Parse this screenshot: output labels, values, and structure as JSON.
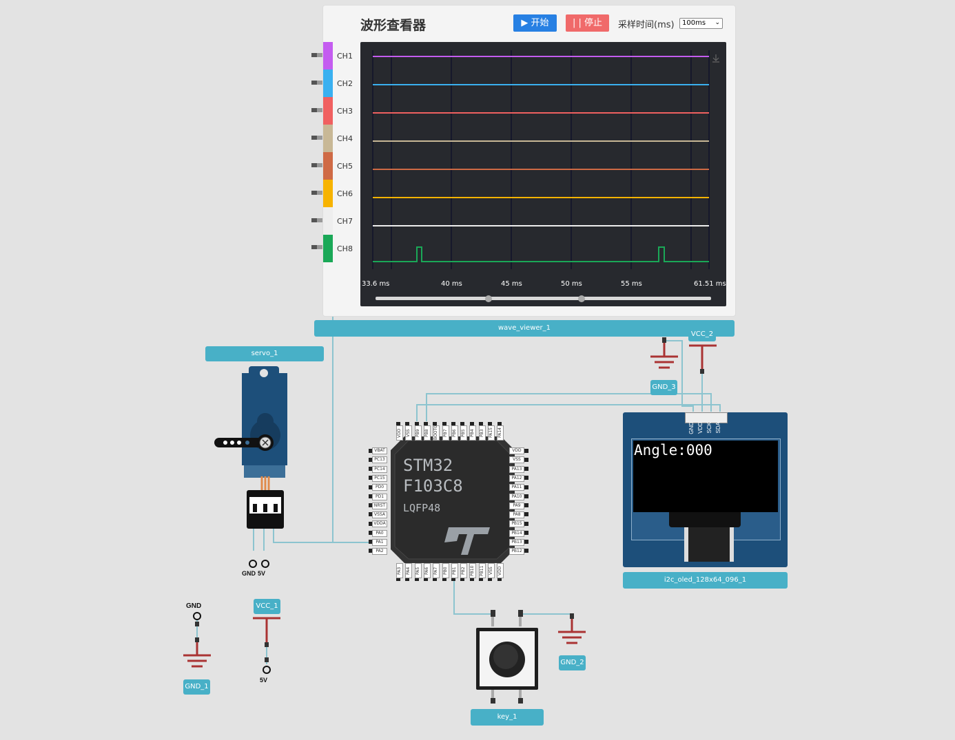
{
  "wave_viewer": {
    "title": "波形查看器",
    "start_label": "▶ 开始",
    "stop_label": "| | 停止",
    "sample_label": "采样时间(ms)",
    "sample_value": "100ms",
    "channels": [
      {
        "label": "CH1",
        "color": "#c45cf0"
      },
      {
        "label": "CH2",
        "color": "#3ab0f0"
      },
      {
        "label": "CH3",
        "color": "#f06060"
      },
      {
        "label": "CH4",
        "color": "#c8b896"
      },
      {
        "label": "CH5",
        "color": "#cf6a45"
      },
      {
        "label": "CH6",
        "color": "#f7b300"
      },
      {
        "label": "CH7",
        "color": "#eeeeee"
      },
      {
        "label": "CH8",
        "color": "#1aa857"
      }
    ],
    "x_ticks": [
      "33.6 ms",
      "40 ms",
      "45 ms",
      "50 ms",
      "55 ms",
      "61.51 ms"
    ],
    "name": "wave_viewer_1"
  },
  "components": {
    "servo": {
      "name": "servo_1",
      "pins": [
        "GND",
        "5V"
      ]
    },
    "mcu": {
      "line1": "STM32",
      "line2": "F103C8",
      "line3": "LQFP48",
      "logo": "ST",
      "top_pins": [
        "VDD",
        "VSS",
        "PB9",
        "PB8",
        "BOOT0",
        "PB7",
        "PB6",
        "PB5",
        "PB4",
        "PB3",
        "PA15",
        "PA14"
      ],
      "left_pins": [
        "VBAT",
        "PC13",
        "PC14",
        "PC15",
        "PD0",
        "PD1",
        "NRST",
        "VSSA",
        "VDDA",
        "PA0",
        "PA1",
        "PA2"
      ],
      "right_pins": [
        "VDD",
        "VSS",
        "PA13",
        "PA12",
        "PA11",
        "PA10",
        "PA9",
        "PA8",
        "PB15",
        "PB14",
        "PB13",
        "PB12"
      ],
      "bottom_pins": [
        "PA3",
        "PA4",
        "PA5",
        "PA6",
        "PA7",
        "PB0",
        "PB1",
        "PB2",
        "PB10",
        "PB11",
        "VSS",
        "VDD"
      ]
    },
    "oled": {
      "name": "i2c_oled_128x64_096_1",
      "pins": [
        "GND",
        "VDD",
        "SCK",
        "SDA"
      ],
      "display_text": "Angle:000"
    },
    "key": {
      "name": "key_1"
    },
    "gnd1": {
      "label": "GND",
      "name": "GND_1"
    },
    "gnd2": {
      "name": "GND_2"
    },
    "gnd3": {
      "name": "GND_3"
    },
    "vcc1": {
      "name": "VCC_1",
      "label": "5V"
    },
    "vcc2": {
      "name": "VCC_2"
    }
  }
}
